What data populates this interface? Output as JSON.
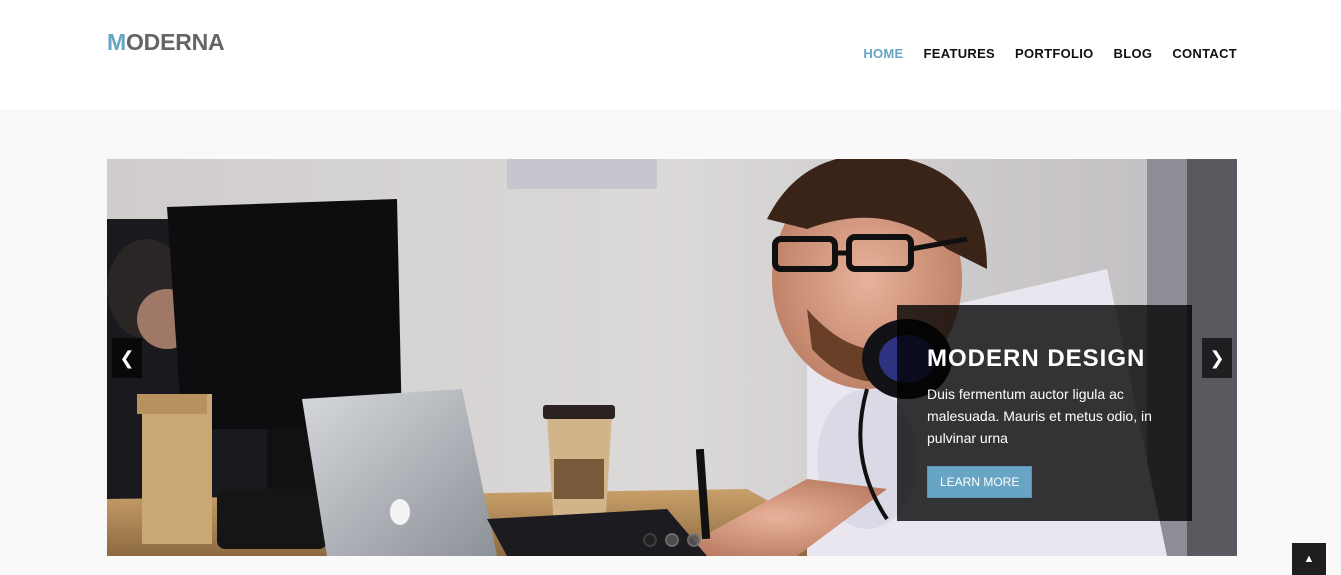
{
  "logo": {
    "first_letter": "M",
    "rest": "ODERNA"
  },
  "nav": {
    "items": [
      {
        "label": "HOME",
        "active": true
      },
      {
        "label": "FEATURES",
        "active": false
      },
      {
        "label": "PORTFOLIO",
        "active": false
      },
      {
        "label": "BLOG",
        "active": false
      },
      {
        "label": "CONTACT",
        "active": false
      }
    ]
  },
  "slider": {
    "caption": {
      "title": "MODERN DESIGN",
      "text": "Duis fermentum auctor ligula ac malesuada. Mauris et metus odio, in pulvinar urna",
      "button_label": "LEARN MORE"
    },
    "prev_icon": "chevron-left-icon",
    "next_icon": "chevron-right-icon",
    "slide_count": 3,
    "active_slide": 1
  },
  "to_top_icon": "chevron-up-icon",
  "colors": {
    "accent": "#68a4c4",
    "text_dark": "#111111",
    "logo_gray": "#656565"
  }
}
